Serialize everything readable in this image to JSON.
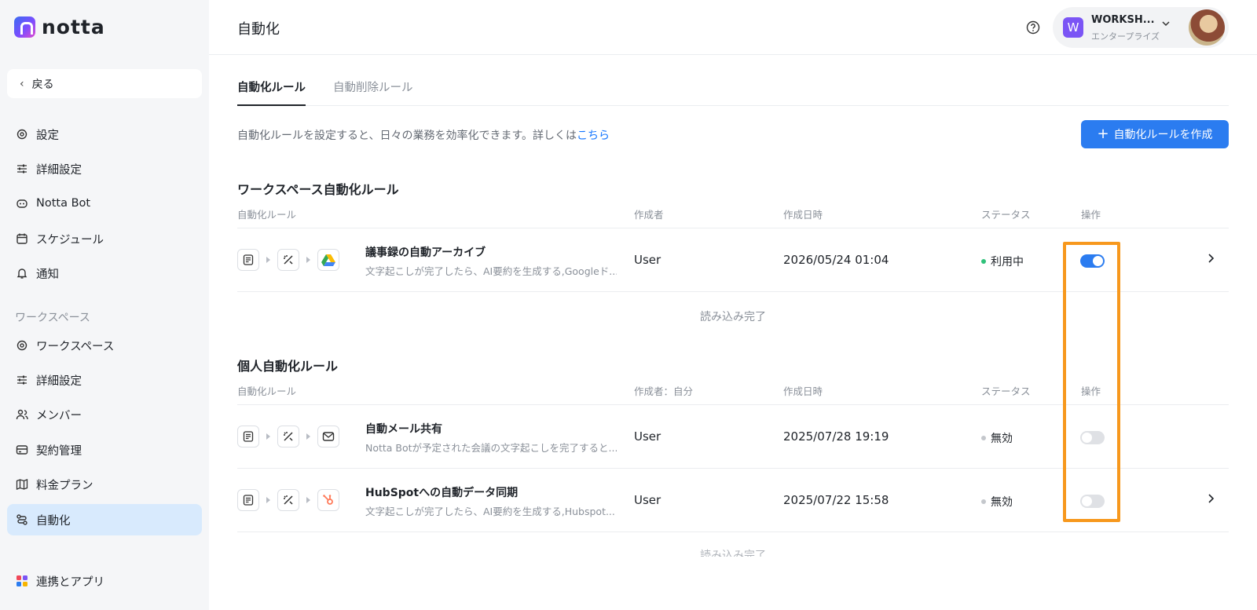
{
  "app": {
    "logo_text": "notta"
  },
  "sidebar": {
    "back_label": "戻る",
    "items": [
      {
        "label": "設定",
        "icon": "gear-icon"
      },
      {
        "label": "詳細設定",
        "icon": "sliders-icon"
      },
      {
        "label": "Notta Bot",
        "icon": "bot-icon"
      },
      {
        "label": "スケジュール",
        "icon": "calendar-icon"
      },
      {
        "label": "通知",
        "icon": "bell-icon"
      }
    ],
    "workspace_section": "ワークスペース",
    "workspace_items": [
      {
        "label": "ワークスペース",
        "icon": "gear-icon"
      },
      {
        "label": "詳細設定",
        "icon": "sliders-icon"
      },
      {
        "label": "メンバー",
        "icon": "users-icon"
      },
      {
        "label": "契約管理",
        "icon": "card-icon"
      },
      {
        "label": "料金プラン",
        "icon": "map-icon"
      },
      {
        "label": "自動化",
        "icon": "automation-icon",
        "active": true
      }
    ],
    "integrations_label": "連携とアプリ"
  },
  "header": {
    "title": "自動化",
    "workspace_badge": "W",
    "workspace_name": "WORKSH...",
    "workspace_plan": "エンタープライズ"
  },
  "tabs": [
    {
      "label": "自動化ルール",
      "active": true
    },
    {
      "label": "自動削除ルール",
      "active": false
    }
  ],
  "description": {
    "text": "自動化ルールを設定すると、日々の業務を効率化できます。詳しくは",
    "link": "こちら"
  },
  "create_button": "自動化ルールを作成",
  "workspace_rules": {
    "title": "ワークスペース自動化ルール",
    "columns": [
      "自動化ルール",
      "作成者",
      "作成日時",
      "ステータス",
      "操作"
    ],
    "rows": [
      {
        "name": "議事録の自動アーカイブ",
        "description": "文字起こしが完了したら、AI要約を生成する,Googleド...",
        "creator": "User",
        "created": "2026/05/24 01:04",
        "status": "利用中",
        "enabled": true,
        "target_icon": "google-drive-icon"
      }
    ],
    "footer": "読み込み完了"
  },
  "personal_rules": {
    "title": "個人自動化ルール",
    "columns": [
      "自動化ルール",
      "作成者：自分",
      "作成日時",
      "ステータス",
      "操作"
    ],
    "rows": [
      {
        "name": "自動メール共有",
        "description": "Notta Botが予定された会議の文字起こしを完了すると...",
        "creator": "User",
        "created": "2025/07/28 19:19",
        "status": "無効",
        "enabled": false,
        "target_icon": "mail-icon"
      },
      {
        "name": "HubSpotへの自動データ同期",
        "description": "文字起こしが完了したら、AI要約を生成する,Hubspot...",
        "creator": "User",
        "created": "2025/07/22 15:58",
        "status": "無効",
        "enabled": false,
        "target_icon": "hubspot-icon"
      }
    ],
    "footer": "読み込み完了"
  },
  "colors": {
    "accent": "#2b7cf0",
    "active_status": "#2fc17a",
    "inactive_status": "#c4c7cc",
    "highlight": "#f7981d"
  }
}
